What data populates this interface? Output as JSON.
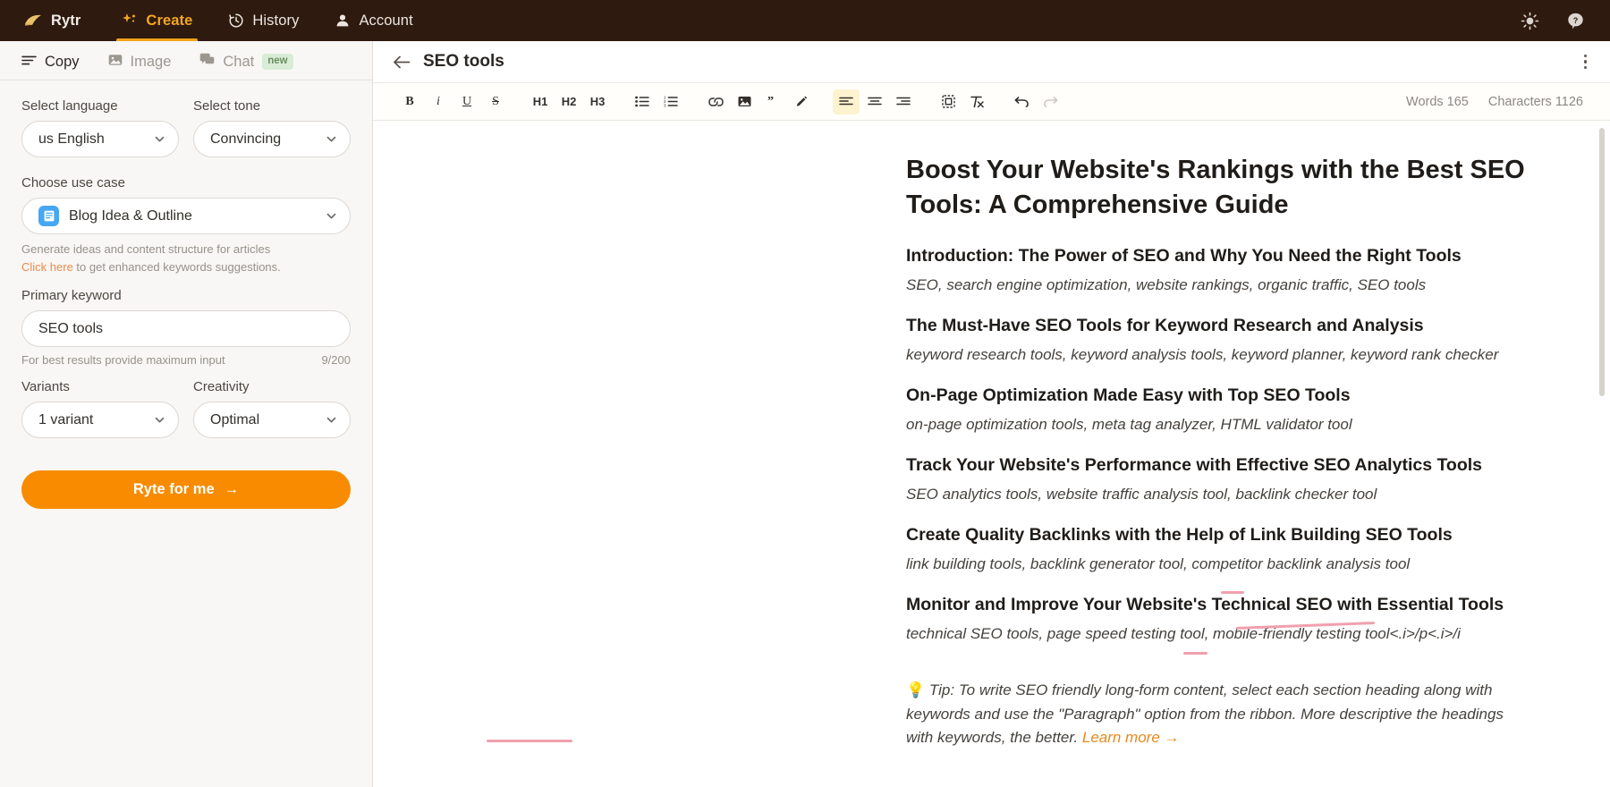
{
  "topnav": {
    "brand": "Rytr",
    "items": [
      {
        "label": "Create",
        "icon": "sparkle-icon",
        "active": true
      },
      {
        "label": "History",
        "icon": "clock-history-icon",
        "active": false
      },
      {
        "label": "Account",
        "icon": "user-icon",
        "active": false
      }
    ],
    "right_icons": [
      {
        "name": "brightness-icon"
      },
      {
        "name": "help-icon"
      }
    ]
  },
  "tabs": [
    {
      "label": "Copy",
      "icon": "lines-icon",
      "active": true,
      "badge": ""
    },
    {
      "label": "Image",
      "icon": "image-icon",
      "active": false,
      "badge": ""
    },
    {
      "label": "Chat",
      "icon": "chat-icon",
      "active": false,
      "badge": "new"
    }
  ],
  "sidebar": {
    "language": {
      "label": "Select language",
      "value": "us English"
    },
    "tone": {
      "label": "Select tone",
      "value": "Convincing"
    },
    "use_case": {
      "label": "Choose use case",
      "value": "Blog Idea & Outline",
      "icon": "document-icon",
      "icon_color": "#45a7f5",
      "helper": "Generate ideas and content structure for articles",
      "link_text": "Click here",
      "link_suffix": " to get enhanced keywords suggestions."
    },
    "primary_keyword": {
      "label": "Primary keyword",
      "value": "SEO tools",
      "placeholder": "Primary keyword",
      "helper": "For best results provide maximum input",
      "counter": "9/200"
    },
    "variants": {
      "label": "Variants",
      "value": "1 variant"
    },
    "creativity": {
      "label": "Creativity",
      "value": "Optimal"
    },
    "submit": {
      "label": "Ryte for me",
      "arrow": "→",
      "color": "#f88b00"
    }
  },
  "editor": {
    "title": "SEO tools",
    "back_icon": "arrow-left-icon",
    "menu_icon": "kebab-menu-icon",
    "toolbar": [
      {
        "name": "bold-button",
        "label": "B",
        "style": "bold"
      },
      {
        "name": "italic-button",
        "label": "i",
        "style": "ital"
      },
      {
        "name": "underline-button",
        "label": "U",
        "style": "und"
      },
      {
        "name": "strikethrough-button",
        "label": "S",
        "style": "strk"
      },
      {
        "name": "heading-1-button",
        "label": "H1",
        "style": "sans"
      },
      {
        "name": "heading-2-button",
        "label": "H2",
        "style": "sans"
      },
      {
        "name": "heading-3-button",
        "label": "H3",
        "style": "sans"
      },
      {
        "name": "bulleted-list-button",
        "label": "",
        "style": "icon"
      },
      {
        "name": "numbered-list-button",
        "label": "",
        "style": "icon"
      },
      {
        "name": "link-button",
        "label": "",
        "style": "icon"
      },
      {
        "name": "image-button",
        "label": "",
        "style": "icon"
      },
      {
        "name": "quote-button",
        "label": "",
        "style": "icon"
      },
      {
        "name": "highlight-pen-button",
        "label": "",
        "style": "icon"
      },
      {
        "name": "align-left-button",
        "label": "",
        "style": "icon",
        "active": true
      },
      {
        "name": "align-center-button",
        "label": "",
        "style": "icon"
      },
      {
        "name": "align-right-button",
        "label": "",
        "style": "icon"
      },
      {
        "name": "insert-block-button",
        "label": "",
        "style": "icon"
      },
      {
        "name": "clear-format-button",
        "label": "",
        "style": "icon"
      },
      {
        "name": "undo-button",
        "label": "",
        "style": "icon"
      },
      {
        "name": "redo-button",
        "label": "",
        "style": "icon",
        "disabled": true
      }
    ],
    "word_count": "Words 165",
    "character_count": "Characters 1126",
    "document": {
      "h1": "Boost Your Website's Rankings with the Best SEO Tools: A Comprehensive Guide",
      "sections": [
        {
          "heading": "Introduction: The Power of SEO and Why You Need the Right Tools",
          "keywords": "SEO, search engine optimization, website rankings, organic traffic, SEO tools"
        },
        {
          "heading": "The Must-Have SEO Tools for Keyword Research and Analysis",
          "keywords": "keyword research tools, keyword analysis tools, keyword planner, keyword rank checker"
        },
        {
          "heading": "On-Page Optimization Made Easy with Top SEO Tools",
          "keywords": "on-page optimization tools, meta tag analyzer, HTML validator tool"
        },
        {
          "heading": "Track Your Website's Performance with Effective SEO Analytics Tools",
          "keywords": "SEO analytics tools, website traffic analysis tool, backlink checker tool"
        },
        {
          "heading": "Create Quality Backlinks with the Help of Link Building SEO Tools",
          "keywords": "link building tools, backlink generator tool, competitor backlink analysis tool"
        },
        {
          "heading": "Monitor and Improve Your Website's Technical SEO with Essential Tools",
          "keywords": "technical SEO tools, page speed testing tool, mobile-friendly testing tool<.i>/p<.i>/i"
        }
      ],
      "tip": {
        "bulb": "💡",
        "text": "Tip: To write SEO friendly long-form content, select each section heading along with keywords and use the \"Paragraph\" option from the ribbon. More descriptive the headings with keywords, the better. ",
        "link": "Learn more →"
      }
    }
  }
}
